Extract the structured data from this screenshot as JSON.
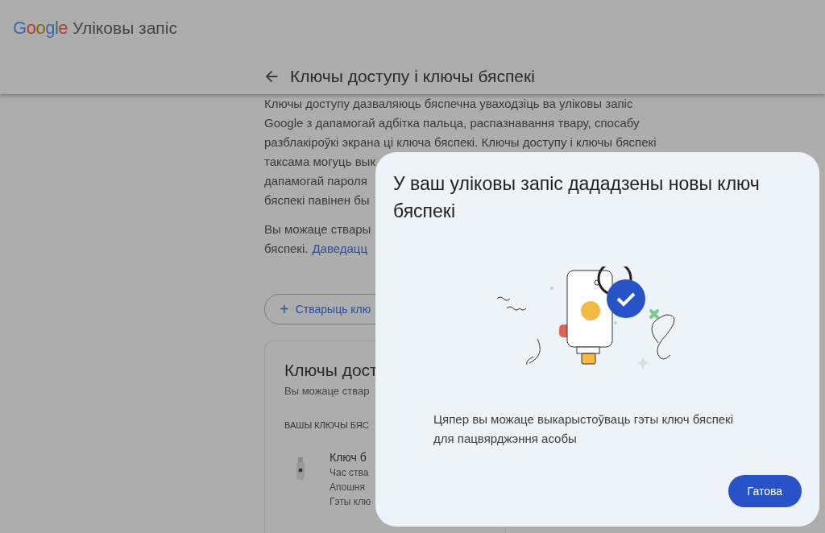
{
  "header": {
    "logo": "Google",
    "product": "Уліковы запіс"
  },
  "page": {
    "title": "Ключы доступу і ключы бяспекі",
    "intro_lines": [
      "Ключы доступу дазваляюць бяспечна уваходзіць ва уліковы запіс",
      "Google з дапамогай адбітка пальца, распазнавання твару, спосабу",
      "разблакіроўкі экрана ці ключа бяспекі. Ключы доступу і ключы бяспекі",
      "таксама могуць вык",
      "дапамогай пароля",
      "бяспекі павінен бы"
    ],
    "second_lines": [
      "Вы можаце ствары",
      "бяспекі."
    ],
    "link": "Даведацц",
    "create_button": "Стварыць клю",
    "create_button_icon": "+",
    "card": {
      "title": "Ключы дост",
      "subtitle": "Вы можаце ствар",
      "section": "ВАШЫ КЛЮЧЫ БЯС",
      "key": {
        "name": "Ключ б",
        "details": [
          "Час ства",
          "Апошня",
          "Гэты клю"
        ]
      }
    }
  },
  "dialog": {
    "title": "У ваш уліковы запіс дададзены новы ключ бяспекі",
    "message": "Цяпер вы можаце выкарыстоўваць гэты ключ бяспекі для пацвярджэння асобы",
    "button": "Гатова"
  }
}
